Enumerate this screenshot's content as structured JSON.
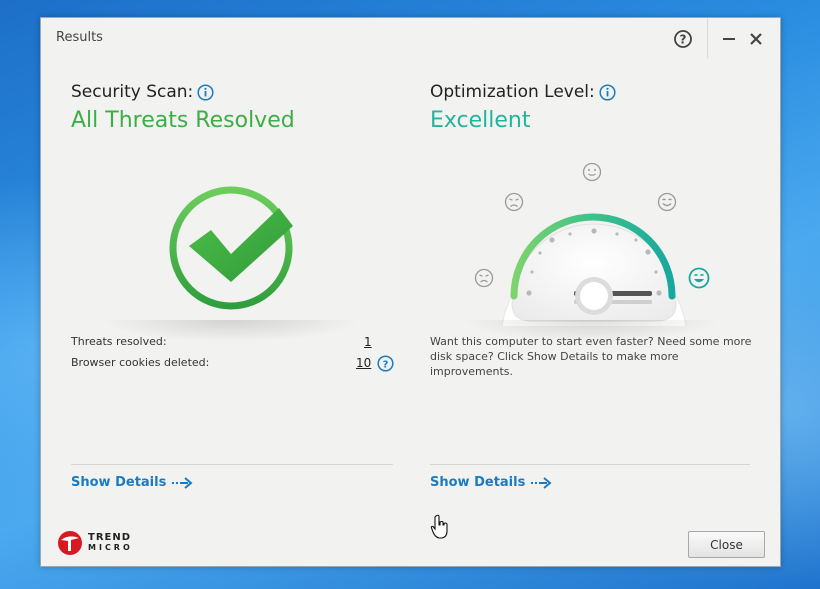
{
  "window": {
    "title": "Results"
  },
  "security": {
    "heading": "Security Scan:",
    "status": "All Threats Resolved",
    "stats": [
      {
        "label": "Threats resolved:",
        "value": "1"
      },
      {
        "label": "Browser cookies deleted:",
        "value": "10"
      }
    ],
    "show_details": "Show Details"
  },
  "optimization": {
    "heading": "Optimization Level:",
    "status": "Excellent",
    "level_percent": 100,
    "description": "Want this computer to start even faster? Need some more disk space? Click Show Details to make more improvements.",
    "show_details": "Show Details"
  },
  "footer": {
    "close_label": "Close",
    "logo_line1": "TREND",
    "logo_line2": "MICRO"
  },
  "colors": {
    "green": "#3cae45",
    "teal": "#22b59c",
    "link": "#1b7bc1",
    "brand_red": "#d71920"
  }
}
